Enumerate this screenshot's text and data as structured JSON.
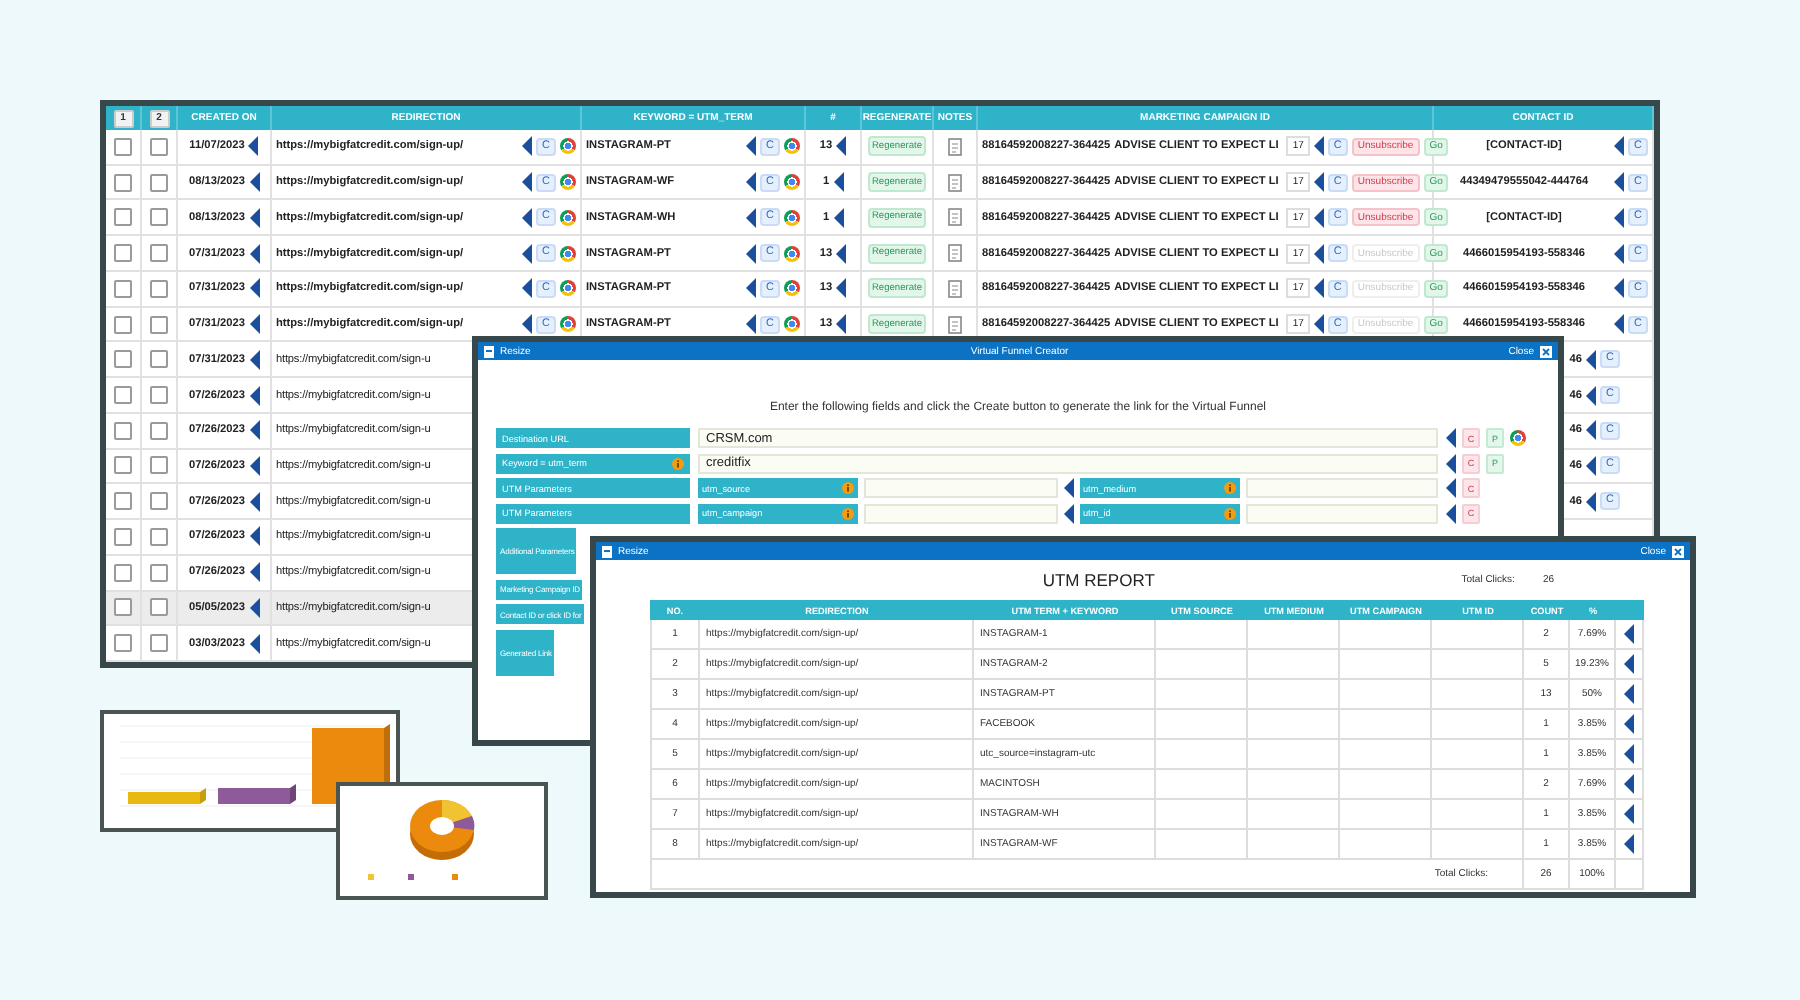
{
  "main_table": {
    "header_buttons": [
      "1",
      "2"
    ],
    "columns": [
      "CREATED ON",
      "REDIRECTION",
      "KEYWORD = UTM_TERM",
      "#",
      "REGENERATE",
      "NOTES",
      "MARKETING CAMPAIGN ID",
      "CONTACT ID"
    ],
    "rows": [
      {
        "kind": "full",
        "selected": false,
        "checked_a": false,
        "checked_b": false,
        "created": "11/07/2023",
        "redirection": "https://mybigfatcredit.com/sign-up/",
        "redirection_copy": "C",
        "keyword": "INSTAGRAM-PT",
        "keyword_copy": "C",
        "count": "13",
        "regenerate": "Regenerate",
        "campaign_id": "88164592008227-364425",
        "advise": "ADVISE CLIENT TO EXPECT LI",
        "number": "17",
        "campaign_copy": "C",
        "unsubscribe": "Unsubscribe",
        "disabled": false,
        "go": "Go",
        "contact_id": "[CONTACT-ID]",
        "contact_copy": "C"
      },
      {
        "kind": "full",
        "selected": false,
        "checked_a": false,
        "checked_b": false,
        "created": "08/13/2023",
        "redirection": "https://mybigfatcredit.com/sign-up/",
        "redirection_copy": "C",
        "keyword": "INSTAGRAM-WF",
        "keyword_copy": "C",
        "count": "1",
        "regenerate": "Regenerate",
        "campaign_id": "88164592008227-364425",
        "advise": "ADVISE CLIENT TO EXPECT LI",
        "number": "17",
        "campaign_copy": "C",
        "unsubscribe": "Unsubscribe",
        "disabled": false,
        "go": "Go",
        "contact_id": "44349479555042-444764",
        "contact_copy": "C"
      },
      {
        "kind": "full",
        "selected": false,
        "checked_a": false,
        "checked_b": false,
        "created": "08/13/2023",
        "redirection": "https://mybigfatcredit.com/sign-up/",
        "redirection_copy": "C",
        "keyword": "INSTAGRAM-WH",
        "keyword_copy": "C",
        "count": "1",
        "regenerate": "Regenerate",
        "campaign_id": "88164592008227-364425",
        "advise": "ADVISE CLIENT TO EXPECT LI",
        "number": "17",
        "campaign_copy": "C",
        "unsubscribe": "Unsubscribe",
        "disabled": false,
        "go": "Go",
        "contact_id": "[CONTACT-ID]",
        "contact_copy": "C"
      },
      {
        "kind": "full",
        "selected": false,
        "checked_a": false,
        "checked_b": false,
        "created": "07/31/2023",
        "redirection": "https://mybigfatcredit.com/sign-up/",
        "redirection_copy": "C",
        "keyword": "INSTAGRAM-PT",
        "keyword_copy": "C",
        "count": "13",
        "regenerate": "Regenerate",
        "campaign_id": "88164592008227-364425",
        "advise": "ADVISE CLIENT TO EXPECT LI",
        "number": "17",
        "campaign_copy": "C",
        "unsubscribe": "Unsubscribe",
        "disabled": true,
        "go": "Go",
        "contact_id": "4466015954193-558346",
        "contact_copy": "C"
      },
      {
        "kind": "full",
        "selected": false,
        "checked_a": false,
        "checked_b": false,
        "created": "07/31/2023",
        "redirection": "https://mybigfatcredit.com/sign-up/",
        "redirection_copy": "C",
        "keyword": "INSTAGRAM-PT",
        "keyword_copy": "C",
        "count": "13",
        "regenerate": "Regenerate",
        "campaign_id": "88164592008227-364425",
        "advise": "ADVISE CLIENT TO EXPECT LI",
        "number": "17",
        "campaign_copy": "C",
        "unsubscribe": "Unsubscribe",
        "disabled": true,
        "go": "Go",
        "contact_id": "4466015954193-558346",
        "contact_copy": "C"
      },
      {
        "kind": "full",
        "selected": false,
        "checked_a": false,
        "checked_b": false,
        "created": "07/31/2023",
        "redirection": "https://mybigfatcredit.com/sign-up/",
        "redirection_copy": "C",
        "keyword": "INSTAGRAM-PT",
        "keyword_copy": "C",
        "count": "13",
        "regenerate": "Regenerate",
        "campaign_id": "88164592008227-364425",
        "advise": "ADVISE CLIENT TO EXPECT LI",
        "number": "17",
        "campaign_copy": "C",
        "unsubscribe": "Unsubscribe",
        "disabled": true,
        "go": "Go",
        "contact_id": "4466015954193-558346",
        "contact_copy": "C"
      },
      {
        "kind": "covered",
        "selected": false,
        "checked_a": false,
        "checked_b": false,
        "created": "07/31/2023",
        "redirection": "https://mybigfatcredit.com/sign-u",
        "contact_tail": "46",
        "contact_copy": "C"
      },
      {
        "kind": "covered",
        "selected": false,
        "checked_a": false,
        "checked_b": false,
        "created": "07/26/2023",
        "redirection": "https://mybigfatcredit.com/sign-u",
        "contact_tail": "46",
        "contact_copy": "C"
      },
      {
        "kind": "covered",
        "selected": false,
        "checked_a": false,
        "checked_b": false,
        "created": "07/26/2023",
        "redirection": "https://mybigfatcredit.com/sign-u",
        "contact_tail": "46",
        "contact_copy": "C"
      },
      {
        "kind": "covered",
        "selected": false,
        "checked_a": false,
        "checked_b": false,
        "created": "07/26/2023",
        "redirection": "https://mybigfatcredit.com/sign-u",
        "contact_tail": "46",
        "contact_copy": "C"
      },
      {
        "kind": "covered",
        "selected": false,
        "checked_a": false,
        "checked_b": false,
        "created": "07/26/2023",
        "redirection": "https://mybigfatcredit.com/sign-u",
        "contact_tail": "46",
        "contact_copy": "C"
      },
      {
        "kind": "covered",
        "selected": false,
        "checked_a": false,
        "checked_b": false,
        "created": "07/26/2023",
        "redirection": "https://mybigfatcredit.com/sign-u"
      },
      {
        "kind": "covered",
        "selected": false,
        "checked_a": false,
        "checked_b": false,
        "created": "07/26/2023",
        "redirection": "https://mybigfatcredit.com/sign-u"
      },
      {
        "kind": "covered",
        "selected": true,
        "checked_a": false,
        "checked_b": false,
        "created": "05/05/2023",
        "redirection": "https://mybigfatcredit.com/sign-u"
      },
      {
        "kind": "covered",
        "selected": false,
        "checked_a": false,
        "checked_b": false,
        "created": "03/03/2023",
        "redirection": "https://mybigfatcredit.com/sign-u"
      }
    ]
  },
  "funnel": {
    "resize": "Resize",
    "title": "Virtual Funnel Creator",
    "close": "Close",
    "instruction": "Enter the following fields and click the Create button to generate the link for the Virtual Funnel",
    "rows": [
      {
        "kind": "single",
        "label": "Destination URL",
        "info": false,
        "value": "CRSM.com",
        "buttons": [
          "C",
          "P"
        ],
        "browser": true
      },
      {
        "kind": "single",
        "label": "Keyword = utm_term",
        "info": true,
        "value": "creditfix",
        "buttons": [
          "C",
          "P"
        ],
        "browser": false
      },
      {
        "kind": "pair",
        "label": "UTM Parameters",
        "params": [
          "utm_source",
          "utm_medium"
        ],
        "buttons": [
          "C"
        ]
      },
      {
        "kind": "pair",
        "label": "UTM Parameters",
        "params": [
          "utm_campaign",
          "utm_id"
        ],
        "buttons": [
          "C"
        ]
      },
      {
        "kind": "tall",
        "label": "Additional Parameters"
      },
      {
        "kind": "label",
        "label": "Marketing Campaign ID"
      },
      {
        "kind": "label",
        "label": "Contact ID or click ID for"
      },
      {
        "kind": "tall",
        "label": "Generated Link"
      }
    ]
  },
  "utm_report": {
    "resize": "Resize",
    "close": "Close",
    "title": "UTM REPORT",
    "total_label": "Total Clicks:",
    "total": "26",
    "columns": [
      "NO.",
      "REDIRECTION",
      "UTM TERM + KEYWORD",
      "UTM SOURCE",
      "UTM MEDIUM",
      "UTM CAMPAIGN",
      "UTM ID",
      "COUNT",
      "%"
    ],
    "rows": [
      {
        "no": "1",
        "redirection": "https://mybigfatcredit.com/sign-up/",
        "term": "INSTAGRAM-1",
        "count": "2",
        "percent": "7.69%"
      },
      {
        "no": "2",
        "redirection": "https://mybigfatcredit.com/sign-up/",
        "term": "INSTAGRAM-2",
        "count": "5",
        "percent": "19.23%"
      },
      {
        "no": "3",
        "redirection": "https://mybigfatcredit.com/sign-up/",
        "term": "INSTAGRAM-PT",
        "count": "13",
        "percent": "50%"
      },
      {
        "no": "4",
        "redirection": "https://mybigfatcredit.com/sign-up/",
        "term": "FACEBOOK",
        "count": "1",
        "percent": "3.85%"
      },
      {
        "no": "5",
        "redirection": "https://mybigfatcredit.com/sign-up/",
        "term": "utc_source=instagram-utc",
        "count": "1",
        "percent": "3.85%"
      },
      {
        "no": "6",
        "redirection": "https://mybigfatcredit.com/sign-up/",
        "term": "MACINTOSH",
        "count": "2",
        "percent": "7.69%"
      },
      {
        "no": "7",
        "redirection": "https://mybigfatcredit.com/sign-up/",
        "term": "INSTAGRAM-WH",
        "count": "1",
        "percent": "3.85%"
      },
      {
        "no": "8",
        "redirection": "https://mybigfatcredit.com/sign-up/",
        "term": "INSTAGRAM-WF",
        "count": "1",
        "percent": "3.85%"
      }
    ],
    "footer": {
      "label": "Total Clicks:",
      "count": "26",
      "percent": "100%"
    }
  },
  "charts": [
    {
      "kind": "bar"
    },
    {
      "kind": "donut"
    }
  ]
}
